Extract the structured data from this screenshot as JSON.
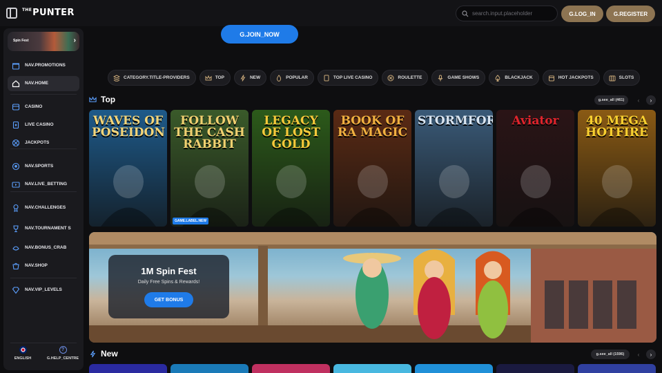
{
  "header": {
    "logo_prefix": "THE",
    "logo": "PUNTER",
    "search_placeholder": "search.input.placeholder",
    "login_label": "G.LOG_IN",
    "register_label": "G.REGISTER"
  },
  "sidebar": {
    "promo_label": "Spin Fest",
    "items": [
      {
        "label": "NAV.PROMOTIONS",
        "icon": "promotions-icon"
      },
      {
        "label": "NAV.HOME",
        "icon": "home-icon"
      },
      {
        "label": "CASINO",
        "icon": "casino-icon"
      },
      {
        "label": "LIVE CASINO",
        "icon": "live-casino-icon"
      },
      {
        "label": "JACKPOTS",
        "icon": "jackpots-icon"
      },
      {
        "label": "NAV.SPORTS",
        "icon": "sports-icon"
      },
      {
        "label": "NAV.LIVE_BETTING",
        "icon": "live-betting-icon"
      },
      {
        "label": "NAV.CHALLENGES",
        "icon": "challenges-icon"
      },
      {
        "label": "NAV.TOURNAMENT S",
        "icon": "trophy-icon"
      },
      {
        "label": "NAV.BONUS_CRAB",
        "icon": "bonus-crab-icon"
      },
      {
        "label": "NAV.SHOP",
        "icon": "shop-icon"
      },
      {
        "label": "NAV.VIP_LEVELS",
        "icon": "diamond-icon"
      }
    ],
    "footer": {
      "language": "ENGLISH",
      "help": "G.HELP_CENTRE"
    }
  },
  "main": {
    "join_label": "G.JOIN_NOW",
    "categories": [
      {
        "label": "CATEGORY.TITLE-PROVIDERS",
        "icon": "providers-icon"
      },
      {
        "label": "TOP",
        "icon": "crown-icon"
      },
      {
        "label": "NEW",
        "icon": "bolt-icon"
      },
      {
        "label": "POPULAR",
        "icon": "flame-icon"
      },
      {
        "label": "TOP LIVE CASINO",
        "icon": "live-card-icon"
      },
      {
        "label": "ROULETTE",
        "icon": "roulette-icon"
      },
      {
        "label": "GAME SHOWS",
        "icon": "microphone-icon"
      },
      {
        "label": "BLACKJACK",
        "icon": "spade-icon"
      },
      {
        "label": "HOT JACKPOTS",
        "icon": "jackpot-icon"
      },
      {
        "label": "SLOTS",
        "icon": "slots-icon"
      }
    ],
    "top_section": {
      "title": "Top",
      "see_all": "g.see_all (461)"
    },
    "games": [
      {
        "title": "WAVES OF POSEIDON",
        "bg": "#1e5a8a",
        "title_color": "#f3d57a"
      },
      {
        "title": "FOLLOW THE CASH RABBIT",
        "bg": "#3a5a2a",
        "title_color": "#f0d070",
        "badge": "GAME.LABEL.NEW"
      },
      {
        "title": "LEGACY OF LOST GOLD",
        "bg": "#2c5a1a",
        "title_color": "#f6c93a"
      },
      {
        "title": "BOOK OF RA MAGIC",
        "bg": "#5a2a14",
        "title_color": "#f0b040"
      },
      {
        "title": "STORMFORGED",
        "bg": "#3a5a78",
        "title_color": "#d8e4f0"
      },
      {
        "title": "Aviator",
        "bg": "#2a1416",
        "title_color": "#e0242c"
      },
      {
        "title": "40 MEGA HOTFIRE",
        "bg": "#8a5a14",
        "title_color": "#f8d030"
      }
    ],
    "banner": {
      "title": "1M Spin Fest",
      "subtitle": "Daily Free Spins & Rewards!",
      "button": "GET BONUS"
    },
    "new_section": {
      "title": "New",
      "see_all": "g.see_all (1596)"
    },
    "new_strip_colors": [
      "#2a2aa0",
      "#1a7ab8",
      "#c03060",
      "#48b8e0",
      "#2090d8",
      "#1a1a40",
      "#3040a0"
    ]
  }
}
